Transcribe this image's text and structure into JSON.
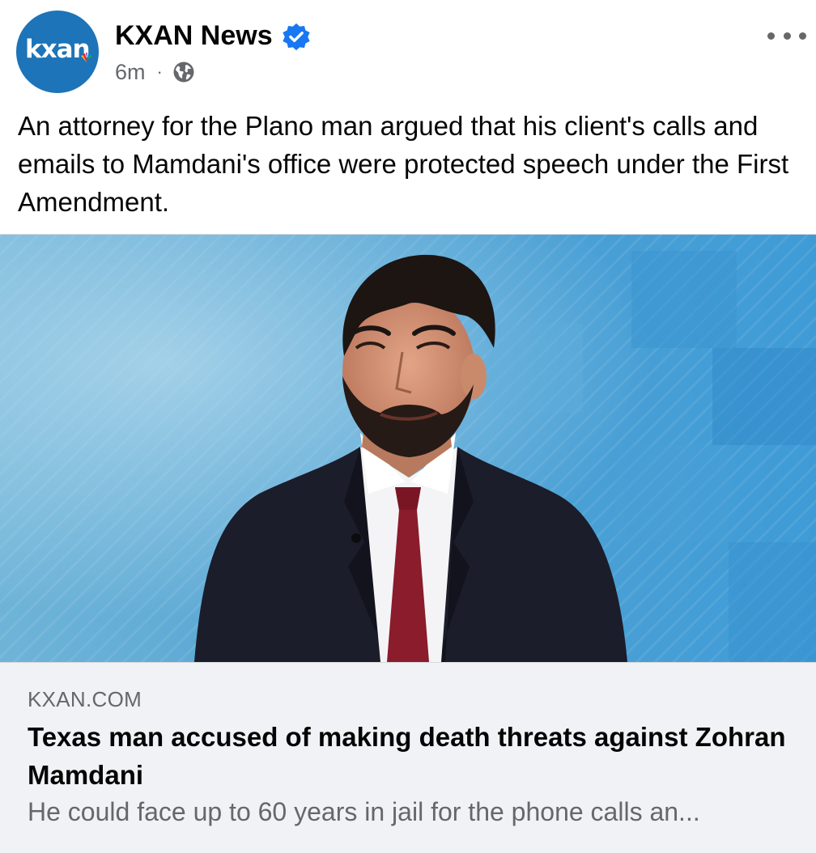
{
  "post": {
    "author": {
      "name": "KXAN News",
      "avatar_text": "kxan",
      "verified": true
    },
    "timestamp": "6m",
    "separator": "·",
    "audience_icon": "globe-icon",
    "caption": "An attorney for the Plano man argued that his client's calls and emails to Mamdani's office were protected speech under the First Amendment."
  },
  "link": {
    "domain": "KXAN.COM",
    "title": "Texas man accused of making death threats against Zohran Mamdani",
    "description": "He could face up to 60 years in jail for the phone calls an..."
  },
  "icons": {
    "verified": "verified-badge-icon",
    "more": "more-options-icon",
    "globe": "globe-icon"
  },
  "colors": {
    "verified_blue": "#1877f2",
    "avatar_blue": "#1d74b8",
    "secondary_text": "#65676b",
    "preview_background": "#f0f2f5",
    "tie_red": "#8a1c2b"
  }
}
